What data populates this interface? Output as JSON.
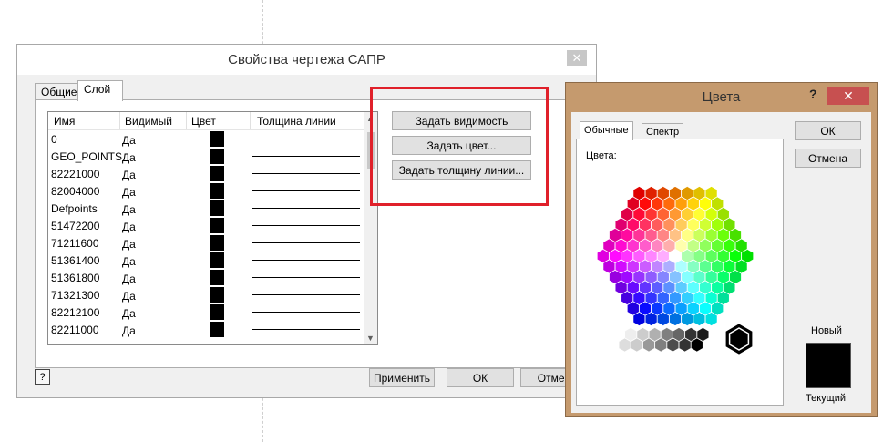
{
  "main_dialog": {
    "title": "Свойства чертежа САПР",
    "close_glyph": "✕",
    "tabs": [
      "Общие",
      "Слой"
    ],
    "columns": [
      "Имя",
      "Видимый",
      "Цвет",
      "Толщина линии"
    ],
    "layers": [
      {
        "name": "0",
        "visible": "Да"
      },
      {
        "name": "GEO_POINTS",
        "visible": "Да"
      },
      {
        "name": "82221000",
        "visible": "Да"
      },
      {
        "name": "82004000",
        "visible": "Да"
      },
      {
        "name": "Defpoints",
        "visible": "Да"
      },
      {
        "name": "51472200",
        "visible": "Да"
      },
      {
        "name": "71211600",
        "visible": "Да"
      },
      {
        "name": "51361400",
        "visible": "Да"
      },
      {
        "name": "51361800",
        "visible": "Да"
      },
      {
        "name": "71321300",
        "visible": "Да"
      },
      {
        "name": "82212100",
        "visible": "Да"
      },
      {
        "name": "82211000",
        "visible": "Да"
      }
    ],
    "side_buttons": [
      "Задать видимость",
      "Задать цвет...",
      "Задать толщину линии..."
    ],
    "footer_buttons": {
      "apply": "Применить",
      "ok": "ОК",
      "cancel": "Отмен"
    },
    "help_glyph": "?"
  },
  "color_dialog": {
    "title": "Цвета",
    "help_glyph": "?",
    "close_glyph": "✕",
    "tabs": [
      "Обычные",
      "Спектр"
    ],
    "colors_label": "Цвета:",
    "ok": "ОК",
    "cancel": "Отмена",
    "new_label": "Новый",
    "current_label": "Текущий",
    "selected_color": "#000000"
  },
  "colors": {
    "highlight": "#e0202a",
    "color_dialog_frame": "#c59a6e"
  }
}
